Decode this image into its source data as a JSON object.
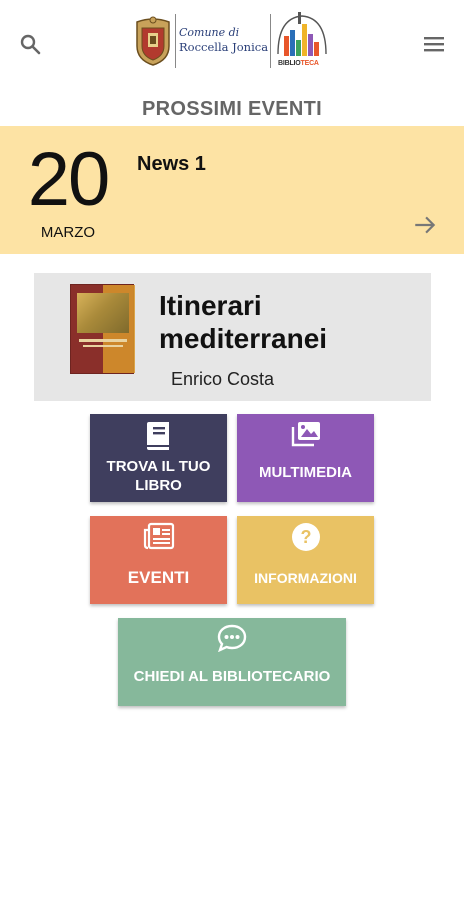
{
  "header": {
    "comune_line1": "Comune di",
    "comune_line2": "Roccella Jonica",
    "biblio_prefix": "BIBLIO",
    "biblio_suffix": "TECA"
  },
  "section": {
    "title": "PROSSIMI EVENTI"
  },
  "event": {
    "day": "20",
    "month": "MARZO",
    "title": "News 1"
  },
  "book": {
    "title": "Itinerari mediterranei",
    "author": "Enrico Costa"
  },
  "tiles": {
    "trova": "TROVA IL TUO LIBRO",
    "multimedia": "MULTIMEDIA",
    "eventi": "EVENTI",
    "informazioni": "INFORMAZIONI",
    "chiedi": "CHIEDI AL BIBLIOTECARIO"
  },
  "colors": {
    "banner": "#fde3a4",
    "trova": "#3f3e5e",
    "multimedia": "#8e58b6",
    "eventi": "#e2725a",
    "informazioni": "#e9c264",
    "chiedi": "#86b89b"
  },
  "icons": {
    "search": "search-icon",
    "menu": "hamburger-menu-icon",
    "next": "arrow-right-icon",
    "trova": "book-icon",
    "multimedia": "photo-library-icon",
    "eventi": "newspaper-icon",
    "informazioni": "help-circle-icon",
    "chiedi": "chat-bubble-icon"
  }
}
